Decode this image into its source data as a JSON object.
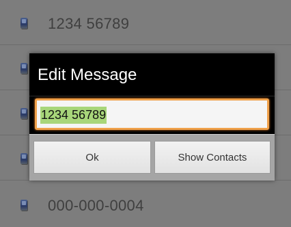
{
  "contacts": [
    {
      "number": "1234 56789"
    },
    {
      "number": ""
    },
    {
      "number": ""
    },
    {
      "number": ""
    },
    {
      "number": "000-000-0004"
    }
  ],
  "dialog": {
    "title": "Edit Message",
    "input_value": "1234 56789",
    "ok_label": "Ok",
    "show_contacts_label": "Show Contacts"
  },
  "colors": {
    "backdrop": "#7d7d7d",
    "dialog_bg": "#000000",
    "input_focus_border": "#f0a14a",
    "text_selection": "#a8d67a",
    "button_bar": "#a5a5a5"
  },
  "icons": [
    "contact-card-icon"
  ]
}
